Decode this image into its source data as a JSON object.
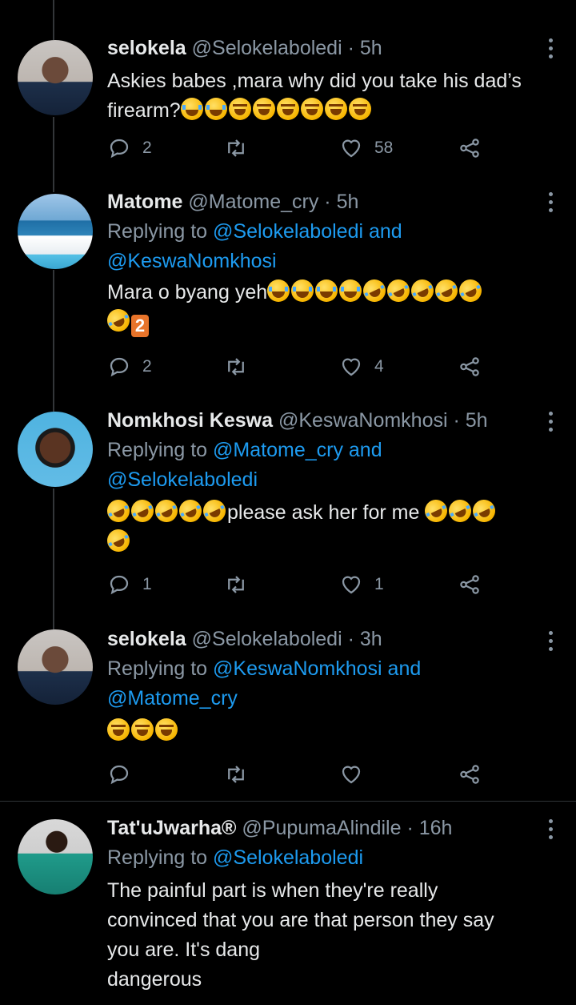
{
  "colors": {
    "background": "#000000",
    "link": "#1d9bf0",
    "muted": "#8b98a5",
    "text": "#e7e9ea"
  },
  "tweets": [
    {
      "name": "selokela",
      "handle": "@Selokelaboledi",
      "dot": "·",
      "time": "5h",
      "text": "Askies babes ,mara why did you take his dad’s firearm?",
      "emoji": [
        "crying-face",
        "crying-face",
        "laughing-face",
        "laughing-face",
        "laughing-face",
        "laughing-face",
        "laughing-face",
        "laughing-face"
      ],
      "replies": "2",
      "likes": "58"
    },
    {
      "name": "Matome",
      "handle": "@Matome_cry",
      "dot": "·",
      "time": "5h",
      "replying_prefix": "Replying to",
      "mention1": "@Selokelaboledi",
      "and": "and",
      "mention2": "@KeswaNomkhosi",
      "text": "Mara o byang yeh",
      "replies": "2",
      "likes": "4"
    },
    {
      "name": "Nomkhosi Keswa",
      "handle": "@KeswaNomkhosi",
      "dot": "·",
      "time": "5h",
      "replying_prefix": "Replying to",
      "mention1": "@Matome_cry",
      "and": "and",
      "mention2": "@Selokelaboledi",
      "text": "please ask her for me",
      "replies": "1",
      "likes": "1"
    },
    {
      "name": "selokela",
      "handle": "@Selokelaboledi",
      "dot": "·",
      "time": "3h",
      "replying_prefix": "Replying to",
      "mention1": "@KeswaNomkhosi",
      "and": "and",
      "mention2": "@Matome_cry",
      "text": "",
      "replies": "",
      "likes": ""
    },
    {
      "name": "Tat'uJwarha®",
      "handle": "@PupumaAlindile",
      "dot": "·",
      "time": "16h",
      "replying_prefix": "Replying to",
      "mention1": "@Selokelaboledi",
      "text_lines": [
        "The painful part is when they're really",
        "convinced that you are that person they say",
        "you are. It's dang",
        "dangerous"
      ]
    }
  ]
}
